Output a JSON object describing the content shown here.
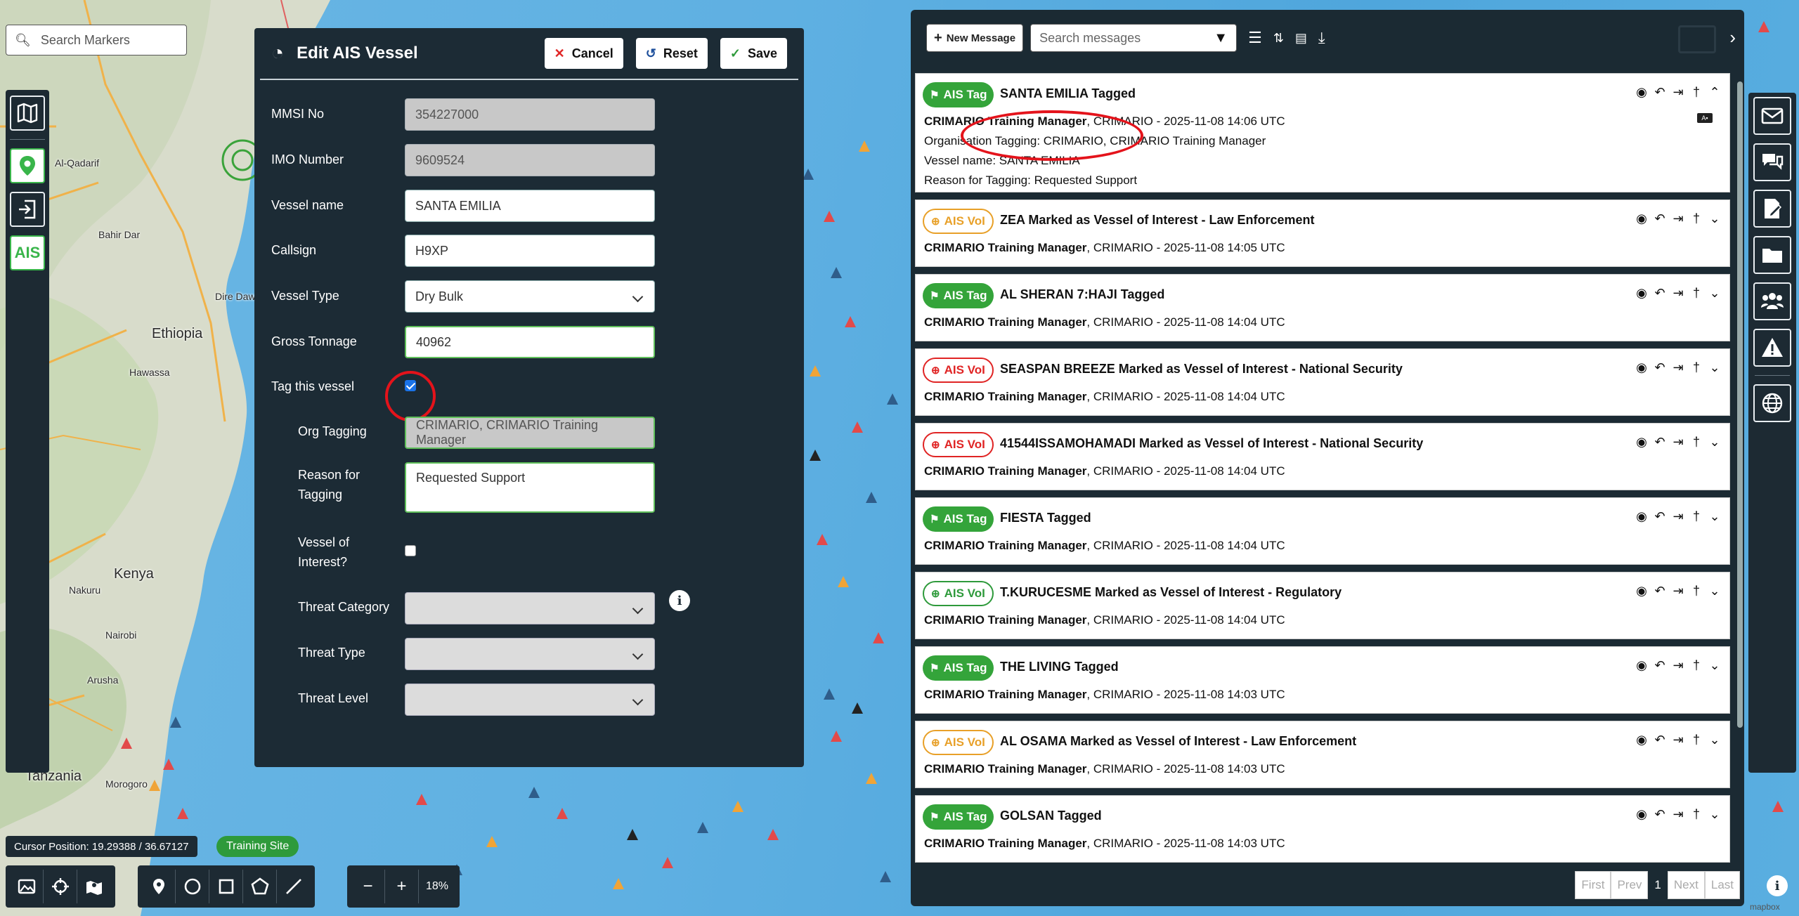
{
  "map": {
    "places": [
      "Al-Qadarif",
      "Bahir Dar",
      "Dire Dawa",
      "Ethiopia",
      "Hawassa",
      "Kenya",
      "Nakuru",
      "Nairobi",
      "Arusha",
      "Tanzania",
      "Morogoro"
    ],
    "search_placeholder": "Search Markers"
  },
  "left_toolbar": {
    "icons": [
      "map-icon",
      "location-pin-icon",
      "login-icon"
    ],
    "ais_label": "AIS"
  },
  "edit_panel": {
    "title": "Edit AIS Vessel",
    "cancel_label": "Cancel",
    "reset_label": "Reset",
    "save_label": "Save",
    "fields": {
      "mmsi_label": "MMSI No",
      "mmsi_value": "354227000",
      "imo_label": "IMO Number",
      "imo_value": "9609524",
      "name_label": "Vessel name",
      "name_value": "SANTA EMILIA",
      "callsign_label": "Callsign",
      "callsign_value": "H9XP",
      "type_label": "Vessel Type",
      "type_value": "Dry Bulk",
      "tonnage_label": "Gross Tonnage",
      "tonnage_value": "40962",
      "tag_label": "Tag this vessel",
      "tag_checked": true,
      "org_label": "Org Tagging",
      "org_value": "CRIMARIO, CRIMARIO  Training Manager",
      "reason_label_1": "Reason for",
      "reason_label_2": "Tagging",
      "reason_value": "Requested Support",
      "voi_label_1": "Vessel of",
      "voi_label_2": "Interest?",
      "voi_checked": false,
      "threat_category_label": "Threat Category",
      "threat_type_label": "Threat Type",
      "threat_level_label": "Threat Level"
    }
  },
  "messages": {
    "new_message_label": "New Message",
    "search_placeholder": "Search messages",
    "items": [
      {
        "badge": "AIS Tag",
        "badge_kind": "tag",
        "title": "SANTA EMILIA Tagged",
        "author": "CRIMARIO Training Manager",
        "meta": ", CRIMARIO - 2025-11-08 14:06 UTC",
        "body_1": "Organisation Tagging: CRIMARIO, CRIMARIO Training Manager",
        "body_2": "Vessel name: SANTA EMILIA",
        "body_3": "Reason for Tagging: Requested Support"
      },
      {
        "badge": "AIS VoI",
        "badge_kind": "voi-orange",
        "title": "ZEA Marked as Vessel of Interest - Law Enforcement",
        "author": "CRIMARIO Training Manager",
        "meta": ", CRIMARIO - 2025-11-08 14:05 UTC"
      },
      {
        "badge": "AIS Tag",
        "badge_kind": "tag",
        "title": "AL SHERAN 7:HAJI Tagged",
        "author": "CRIMARIO Training Manager",
        "meta": ", CRIMARIO - 2025-11-08 14:04 UTC"
      },
      {
        "badge": "AIS VoI",
        "badge_kind": "voi-red",
        "title": "SEASPAN BREEZE Marked as Vessel of Interest - National Security",
        "author": "CRIMARIO Training Manager",
        "meta": ", CRIMARIO - 2025-11-08 14:04 UTC"
      },
      {
        "badge": "AIS VoI",
        "badge_kind": "voi-red",
        "title": "41544ISSAMOHAMADI Marked as Vessel of Interest - National Security",
        "author": "CRIMARIO Training Manager",
        "meta": ", CRIMARIO - 2025-11-08 14:04 UTC"
      },
      {
        "badge": "AIS Tag",
        "badge_kind": "tag",
        "title": "FIESTA Tagged",
        "author": "CRIMARIO Training Manager",
        "meta": ", CRIMARIO - 2025-11-08 14:04 UTC"
      },
      {
        "badge": "AIS VoI",
        "badge_kind": "voi-green",
        "title": "T.KURUCESME Marked as Vessel of Interest - Regulatory",
        "author": "CRIMARIO Training Manager",
        "meta": ", CRIMARIO - 2025-11-08 14:04 UTC"
      },
      {
        "badge": "AIS Tag",
        "badge_kind": "tag",
        "title": "THE LIVING Tagged",
        "author": "CRIMARIO Training Manager",
        "meta": ", CRIMARIO - 2025-11-08 14:03 UTC"
      },
      {
        "badge": "AIS VoI",
        "badge_kind": "voi-orange",
        "title": "AL OSAMA Marked as Vessel of Interest - Law Enforcement",
        "author": "CRIMARIO Training Manager",
        "meta": ", CRIMARIO - 2025-11-08 14:03 UTC"
      },
      {
        "badge": "AIS Tag",
        "badge_kind": "tag",
        "title": "GOLSAN Tagged",
        "author": "CRIMARIO Training Manager",
        "meta": ", CRIMARIO - 2025-11-08 14:03 UTC"
      }
    ],
    "pager": {
      "first": "First",
      "prev": "Prev",
      "current": "1",
      "next": "Next",
      "last": "Last"
    }
  },
  "right_toolbar": {
    "icons": [
      "mail-icon",
      "chat-icon",
      "edit-document-icon",
      "folder-icon",
      "users-icon",
      "warning-icon",
      "globe-icon"
    ]
  },
  "bottom": {
    "cursor_position": "Cursor Position: 19.29388 / 36.67127",
    "site_badge": "Training Site",
    "zoom_percent": "18%",
    "mapbox": "mapbox"
  },
  "colors": {
    "panel_bg": "#1c2b35",
    "accent_green": "#34a43a",
    "voi_orange": "#e8a028",
    "voi_red": "#e02424",
    "annotation_red": "#e4131b"
  }
}
